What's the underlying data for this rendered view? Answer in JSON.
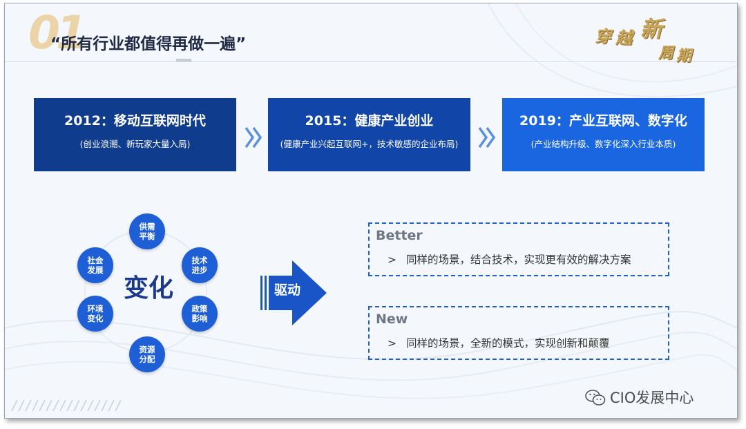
{
  "header": {
    "number": "01",
    "title": "“所有行业都值得再做一遍”",
    "logo_chars": [
      "穿",
      "越",
      "新",
      "周",
      "期"
    ]
  },
  "eras": [
    {
      "title": "2012：移动互联网时代",
      "subtitle": "(创业浪潮、新玩家大量入局)",
      "color": "#0f3c8c"
    },
    {
      "title": "2015：健康产业创业",
      "subtitle": "(健康产业兴起互联网+，技术敏感的企业布局)",
      "color": "#1146a8"
    },
    {
      "title": "2019：产业互联网、数字化",
      "subtitle": "(产业结构升级、数字化深入行业本质)",
      "color": "#1a66e0"
    }
  ],
  "factors": {
    "center": "变化",
    "items": [
      {
        "line1": "供需",
        "line2": "平衡"
      },
      {
        "line1": "技术",
        "line2": "进步"
      },
      {
        "line1": "政策",
        "line2": "影响"
      },
      {
        "line1": "资源",
        "line2": "分配"
      },
      {
        "line1": "环境",
        "line2": "变化"
      },
      {
        "line1": "社会",
        "line2": "发展"
      }
    ]
  },
  "drive": {
    "label": "驱动"
  },
  "outcomes": [
    {
      "head": "Better",
      "marker": ">",
      "text": "同样的场景，结合技术，实现更有效的解决方案"
    },
    {
      "head": "New",
      "marker": ">",
      "text": "同样的场景，全新的模式，实现创新和颠覆"
    }
  ],
  "watermark": {
    "text": "CIO发展中心",
    "icon": "wechat-icon"
  },
  "colors": {
    "accent": "#1f5fd6",
    "dark_blue": "#0f3c8c",
    "gold": "#c9a65a"
  }
}
